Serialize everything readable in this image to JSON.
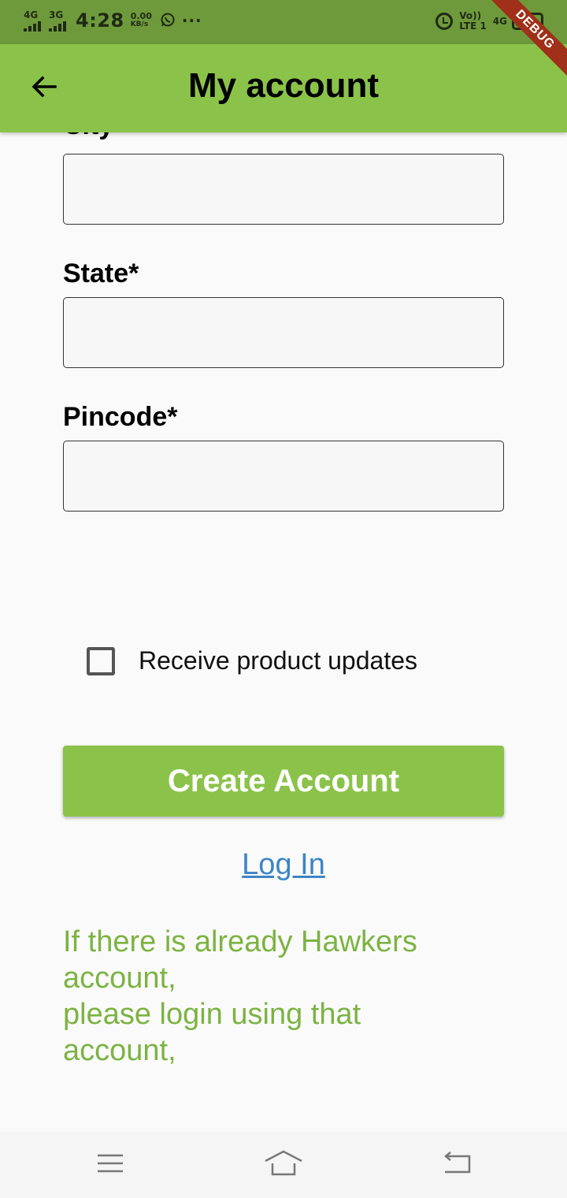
{
  "status_bar": {
    "net1": "4G",
    "net2": "3G",
    "time": "4:28",
    "speed_value": "0.00",
    "speed_unit": "KB/s",
    "dots": "···",
    "volte_top": "Vo))",
    "volte_bottom": "LTE 1",
    "net3": "4G"
  },
  "debug_banner": "DEBUG",
  "app_bar": {
    "title": "My account",
    "back_icon": "arrow-left-icon"
  },
  "form": {
    "city_label": "City",
    "state_label": "State*",
    "pincode_label": "Pincode*",
    "city_value": "",
    "state_value": "",
    "pincode_value": ""
  },
  "checkbox": {
    "label": "Receive product updates",
    "checked": false
  },
  "create_button": "Create Account",
  "login_link": "Log In",
  "info": {
    "line1": "If there is already Hawkers account,",
    "line2": "please login using that account,"
  },
  "nav_bar": {
    "icons": [
      "menu-icon",
      "home-icon",
      "back-icon"
    ]
  },
  "colors": {
    "primary": "#8bc34a",
    "status_bar": "#6e9a3c",
    "link": "#3d85c6",
    "info_text": "#7cb342"
  }
}
